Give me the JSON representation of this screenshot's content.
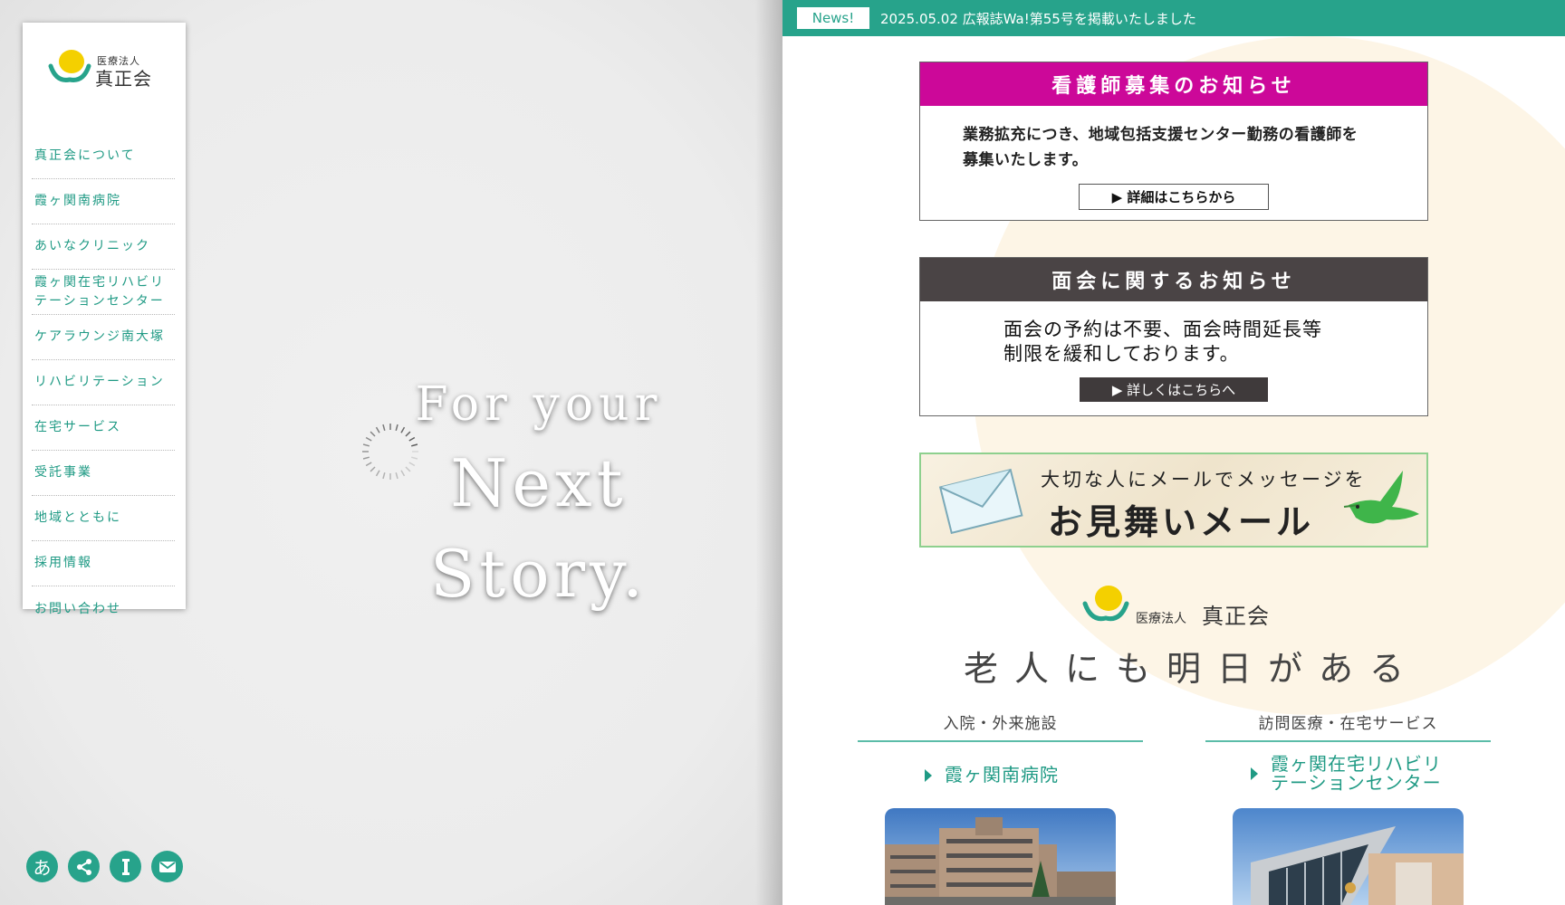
{
  "brand": {
    "org_type": "医療法人",
    "org_name": "真正会"
  },
  "sidebar": {
    "items": [
      {
        "label": "真正会について"
      },
      {
        "label": "霞ヶ関南病院"
      },
      {
        "label": "あいなクリニック"
      },
      {
        "label": "霞ヶ関在宅リハビリテーションセンター"
      },
      {
        "label": "ケアラウンジ南大塚"
      },
      {
        "label": "リハビリテーション"
      },
      {
        "label": "在宅サービス"
      },
      {
        "label": "受託事業"
      },
      {
        "label": "地域とともに"
      },
      {
        "label": "採用情報"
      },
      {
        "label": "お問い合わせ"
      }
    ]
  },
  "hero": {
    "line1": "For your",
    "line2": "Next Story."
  },
  "left_tools": {
    "font_size_glyph": "あ",
    "font_size_icon": "font-size-icon",
    "share_icon": "share-icon",
    "info_icon": "info-icon",
    "mail_icon": "mail-icon"
  },
  "news": {
    "badge": "News!",
    "text": "2025.05.02 広報誌Wa!第55号を掲載いたしました"
  },
  "notice1": {
    "title": "看護師募集のお知らせ",
    "line1": "業務拡充につき、地域包括支援センター勤務の看護師を",
    "line2": "募集いたします。",
    "button": "▶ 詳細はこちらから",
    "color": "#cc0899"
  },
  "notice2": {
    "title": "面会に関するお知らせ",
    "line1": "面会の予約は不要、面会時間延長等",
    "line2": "制限を緩和しております。",
    "button": "▶ 詳しくはこちらへ",
    "color": "#4a4445"
  },
  "mail_banner": {
    "line1": "大切な人にメールでメッセージを",
    "line2": "お見舞いメール"
  },
  "tagline": "老人にも明日がある",
  "columns": [
    {
      "title": "入院・外来施設",
      "facility_line1": "霞ヶ関南病院",
      "facility_line2": ""
    },
    {
      "title": "訪問医療・在宅サービス",
      "facility_line1": "霞ヶ関在宅リハビリ",
      "facility_line2": "テーションセンター"
    }
  ],
  "colors": {
    "accent": "#27a38b",
    "link": "#1f9a84",
    "logo_yellow": "#f4d000"
  }
}
